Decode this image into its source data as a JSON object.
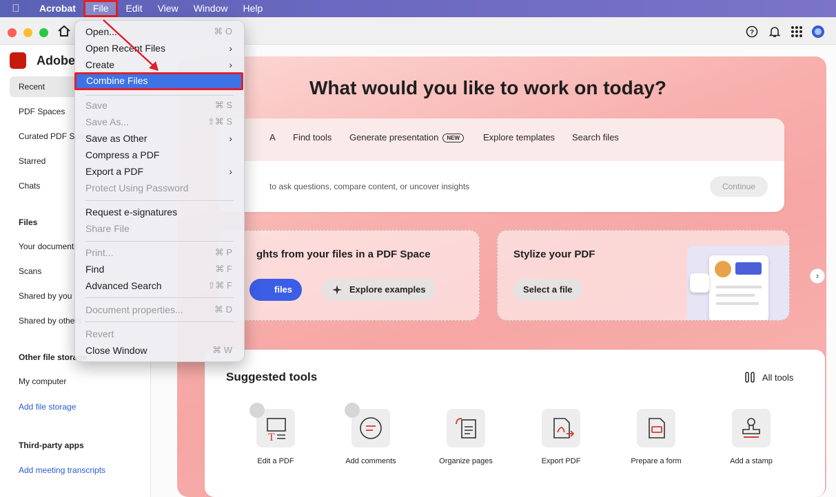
{
  "menubar": {
    "app": "Acrobat",
    "items": [
      "File",
      "Edit",
      "View",
      "Window",
      "Help"
    ]
  },
  "sidebar": {
    "brand": "Adobe",
    "nav": [
      "Recent",
      "PDF Spaces",
      "Curated PDF Spaces",
      "Starred",
      "Chats"
    ],
    "files_head": "Files",
    "files": [
      "Your documents",
      "Scans",
      "Shared by you",
      "Shared by others"
    ],
    "storage_head": "Other file storage",
    "storage": [
      "My computer"
    ],
    "add_storage": "Add file storage",
    "apps_head": "Third-party apps",
    "add_transcripts": "Add meeting transcripts"
  },
  "hero": {
    "title": "What would you like to work on today?",
    "tabs": [
      "A",
      "Find tools",
      "Generate presentation",
      "Explore templates",
      "Search files"
    ],
    "new_badge": "NEW",
    "prompt": "to ask questions, compare content, or uncover insights",
    "continue": "Continue"
  },
  "feature1": {
    "title": "ghts from your files in a PDF Space",
    "btn_primary": "files",
    "btn_secondary": "Explore examples"
  },
  "feature2": {
    "title": "Stylize your PDF",
    "btn": "Select a file"
  },
  "tools": {
    "title": "Suggested tools",
    "all": "All tools",
    "items": [
      "Edit a PDF",
      "Add comments",
      "Organize pages",
      "Export PDF",
      "Prepare a form",
      "Add a stamp"
    ]
  },
  "file_menu": {
    "open": "Open...",
    "open_sc": "⌘ O",
    "open_recent": "Open Recent Files",
    "create": "Create",
    "combine": "Combine Files",
    "save": "Save",
    "save_sc": "⌘ S",
    "save_as": "Save As...",
    "save_as_sc": "⇧⌘ S",
    "save_other": "Save as Other",
    "compress": "Compress a PDF",
    "export": "Export a PDF",
    "protect": "Protect Using Password",
    "request_sig": "Request e-signatures",
    "share": "Share File",
    "print": "Print...",
    "print_sc": "⌘ P",
    "find": "Find",
    "find_sc": "⌘ F",
    "adv_search": "Advanced Search",
    "adv_search_sc": "⇧⌘ F",
    "doc_props": "Document properties...",
    "doc_props_sc": "⌘ D",
    "revert": "Revert",
    "close": "Close Window",
    "close_sc": "⌘ W"
  }
}
